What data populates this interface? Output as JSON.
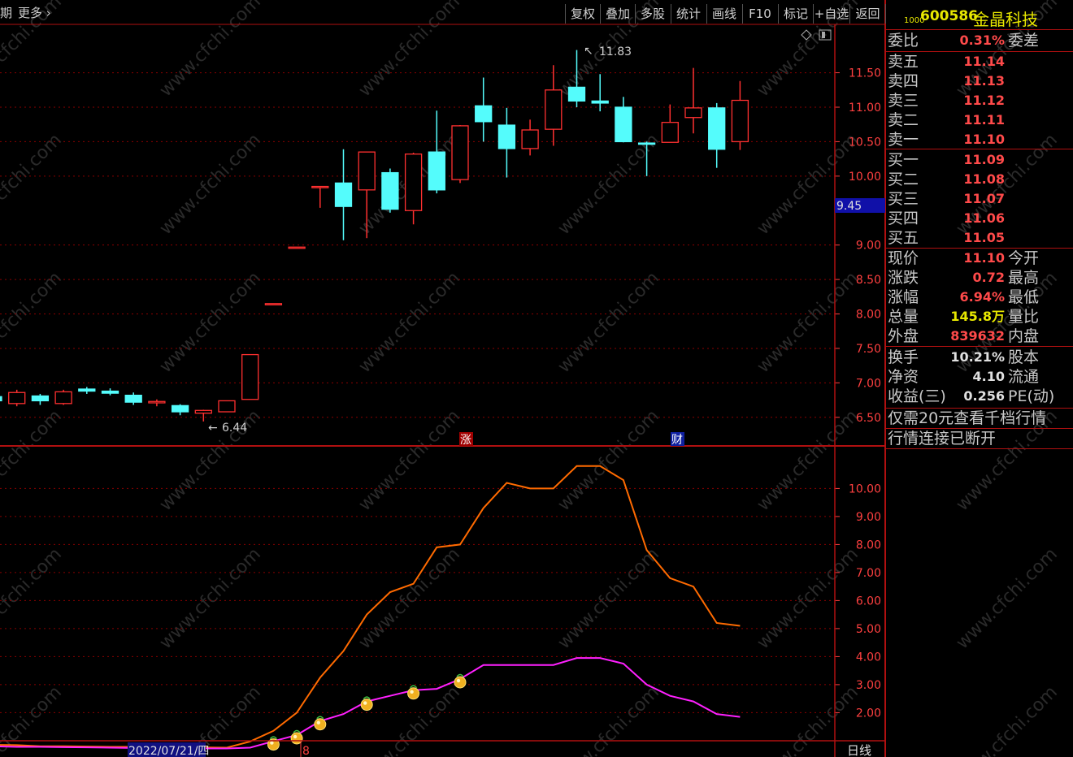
{
  "toolbar": {
    "period_fragment": "期",
    "more_label": "更多",
    "buttons": [
      "复权",
      "叠加",
      "多股",
      "统计",
      "画线",
      "F10",
      "标记",
      "+自选",
      "返回"
    ]
  },
  "stock": {
    "code_prefix": "1000",
    "code": "600586",
    "name": "金晶科技"
  },
  "order_book": {
    "weibi_label": "委比",
    "weibi_value": "0.31%",
    "weicha_label": "委差",
    "asks": [
      {
        "label": "卖五",
        "price": "11.14"
      },
      {
        "label": "卖四",
        "price": "11.13"
      },
      {
        "label": "卖三",
        "price": "11.12"
      },
      {
        "label": "卖二",
        "price": "11.11"
      },
      {
        "label": "卖一",
        "price": "11.10"
      }
    ],
    "bids": [
      {
        "label": "买一",
        "price": "11.09"
      },
      {
        "label": "买二",
        "price": "11.08"
      },
      {
        "label": "买三",
        "price": "11.07"
      },
      {
        "label": "买四",
        "price": "11.06"
      },
      {
        "label": "买五",
        "price": "11.05"
      }
    ]
  },
  "quote": [
    {
      "label": "现价",
      "value": "11.10",
      "color": "red",
      "suffix": "今开"
    },
    {
      "label": "涨跌",
      "value": "0.72",
      "color": "red",
      "suffix": "最高"
    },
    {
      "label": "涨幅",
      "value": "6.94%",
      "color": "red",
      "suffix": "最低"
    },
    {
      "label": "总量",
      "value": "145.8万",
      "color": "yellow",
      "suffix": "量比"
    },
    {
      "label": "外盘",
      "value": "839632",
      "color": "red",
      "suffix": "内盘"
    }
  ],
  "fundamentals": [
    {
      "label": "换手",
      "value": "10.21%",
      "suffix": "股本"
    },
    {
      "label": "净资",
      "value": "4.10",
      "suffix": "流通"
    },
    {
      "label": "收益(三)",
      "value": "0.256",
      "suffix": "PE(动)"
    }
  ],
  "promo_text": "仅需20元查看千档行情",
  "connection_status": "行情连接已断开",
  "status_bar": {
    "date_label": "2022/07/21/四",
    "cursor_fragment": "8",
    "period_label": "日线"
  },
  "price_axis_labels": [
    "11.50",
    "11.00",
    "10.50",
    "10.00",
    "9.00",
    "8.50",
    "8.00",
    "7.50",
    "7.00",
    "6.50"
  ],
  "cursor_price": "9.45",
  "indicator_axis_labels": [
    "10.00",
    "9.00",
    "8.00",
    "7.00",
    "6.00",
    "5.00",
    "4.00",
    "3.00",
    "2.00"
  ],
  "annotations": {
    "high_marker": "11.83",
    "low_marker": "6.44",
    "event_zhang": "涨",
    "event_cai": "财"
  },
  "watermark_text": "www.cfchi.com",
  "colors": {
    "up": "#ff3030",
    "down": "#54fcfc",
    "grid": "#8b0000",
    "orange_line": "#ff6a00",
    "magenta_line": "#ff20ff"
  },
  "chart_data": {
    "type": "candlestick",
    "candles": [
      {
        "o": 6.8,
        "h": 6.85,
        "l": 6.72,
        "c": 6.74
      },
      {
        "o": 6.7,
        "h": 6.9,
        "l": 6.66,
        "c": 6.86
      },
      {
        "o": 6.81,
        "h": 6.84,
        "l": 6.68,
        "c": 6.74
      },
      {
        "o": 6.7,
        "h": 6.9,
        "l": 6.68,
        "c": 6.87
      },
      {
        "o": 6.91,
        "h": 6.94,
        "l": 6.84,
        "c": 6.88
      },
      {
        "o": 6.88,
        "h": 6.92,
        "l": 6.82,
        "c": 6.85
      },
      {
        "o": 6.82,
        "h": 6.86,
        "l": 6.68,
        "c": 6.72
      },
      {
        "o": 6.71,
        "h": 6.76,
        "l": 6.66,
        "c": 6.73
      },
      {
        "o": 6.67,
        "h": 6.69,
        "l": 6.53,
        "c": 6.58
      },
      {
        "o": 6.56,
        "h": 6.61,
        "l": 6.44,
        "c": 6.6
      },
      {
        "o": 6.58,
        "h": 6.74,
        "l": 6.58,
        "c": 6.74
      },
      {
        "o": 6.76,
        "h": 7.41,
        "l": 6.76,
        "c": 7.41
      },
      {
        "o": 8.15,
        "h": 8.15,
        "l": 8.15,
        "c": 8.15
      },
      {
        "o": 8.97,
        "h": 8.97,
        "l": 8.97,
        "c": 8.97
      },
      {
        "o": 9.85,
        "h": 9.85,
        "l": 9.54,
        "c": 9.85
      },
      {
        "o": 9.9,
        "h": 10.39,
        "l": 9.07,
        "c": 9.56
      },
      {
        "o": 9.8,
        "h": 10.35,
        "l": 9.1,
        "c": 10.35
      },
      {
        "o": 10.05,
        "h": 10.11,
        "l": 9.47,
        "c": 9.52
      },
      {
        "o": 9.5,
        "h": 10.34,
        "l": 9.3,
        "c": 10.32
      },
      {
        "o": 10.35,
        "h": 10.95,
        "l": 9.75,
        "c": 9.8
      },
      {
        "o": 9.95,
        "h": 10.74,
        "l": 9.9,
        "c": 10.73
      },
      {
        "o": 11.02,
        "h": 11.43,
        "l": 10.5,
        "c": 10.79
      },
      {
        "o": 10.74,
        "h": 10.99,
        "l": 9.98,
        "c": 10.4
      },
      {
        "o": 10.4,
        "h": 10.82,
        "l": 10.3,
        "c": 10.67
      },
      {
        "o": 10.68,
        "h": 11.61,
        "l": 10.44,
        "c": 11.25
      },
      {
        "o": 11.29,
        "h": 11.83,
        "l": 11.0,
        "c": 11.09
      },
      {
        "o": 11.09,
        "h": 11.48,
        "l": 10.94,
        "c": 11.06
      },
      {
        "o": 11.0,
        "h": 11.15,
        "l": 10.49,
        "c": 10.5
      },
      {
        "o": 10.48,
        "h": 10.5,
        "l": 10.0,
        "c": 10.47
      },
      {
        "o": 10.49,
        "h": 11.04,
        "l": 10.49,
        "c": 10.78
      },
      {
        "o": 10.85,
        "h": 11.57,
        "l": 10.62,
        "c": 10.99
      },
      {
        "o": 10.99,
        "h": 11.06,
        "l": 10.12,
        "c": 10.39
      },
      {
        "o": 10.5,
        "h": 11.38,
        "l": 10.38,
        "c": 11.1
      }
    ],
    "price_range": [
      6.25,
      11.99
    ],
    "indicator": {
      "range": [
        1.2,
        11.2
      ],
      "orange": [
        0.85,
        0.84,
        0.8,
        0.8,
        0.79,
        0.78,
        0.78,
        0.77,
        0.76,
        0.76,
        0.75,
        0.97,
        1.35,
        2.0,
        3.25,
        4.2,
        5.5,
        6.3,
        6.6,
        7.9,
        8.0,
        9.3,
        10.2,
        10.0,
        10.0,
        10.8,
        10.8,
        10.3,
        7.8,
        6.8,
        6.5,
        5.2,
        5.1
      ],
      "magenta": [
        0.8,
        0.78,
        0.78,
        0.77,
        0.76,
        0.75,
        0.74,
        0.74,
        0.73,
        0.72,
        0.72,
        0.75,
        0.98,
        1.2,
        1.7,
        1.95,
        2.4,
        2.6,
        2.8,
        2.85,
        3.2,
        3.7,
        3.7,
        3.7,
        3.7,
        3.95,
        3.95,
        3.75,
        3.0,
        2.6,
        2.4,
        1.95,
        1.85
      ]
    },
    "buy_signal_indices": [
      12,
      13,
      14,
      16,
      18,
      20
    ]
  }
}
